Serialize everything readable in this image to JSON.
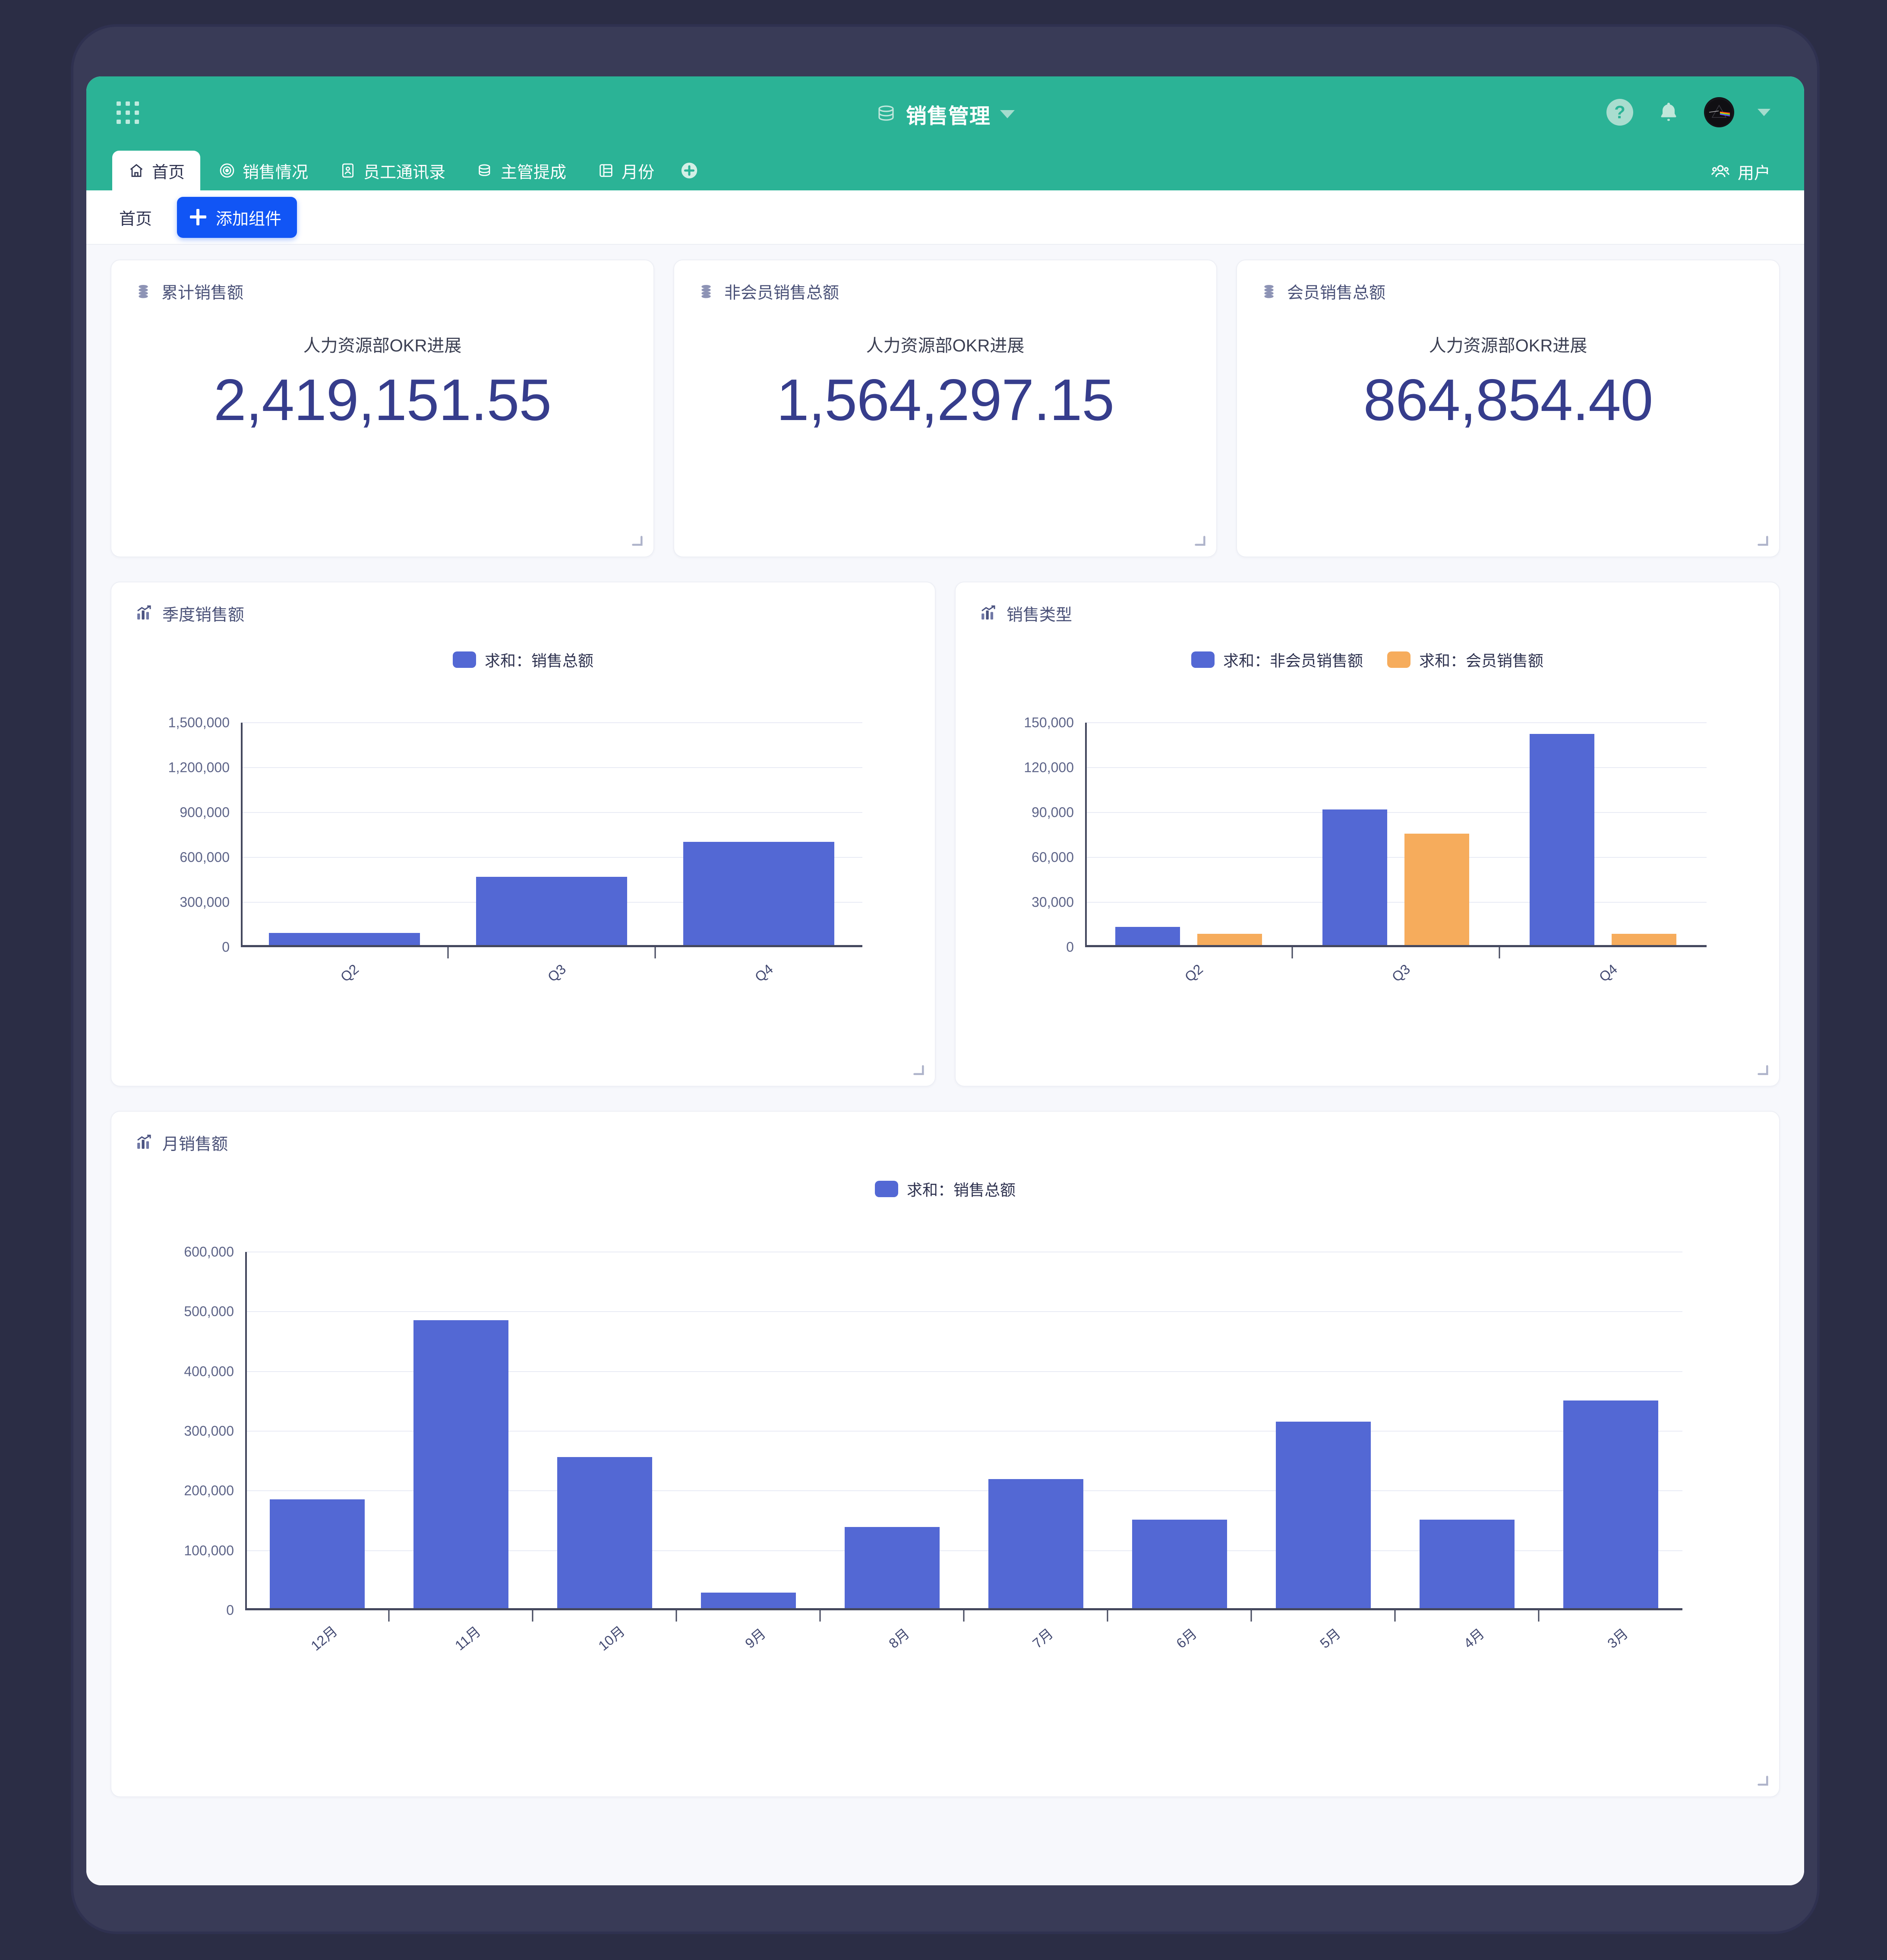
{
  "header": {
    "app_icon": "grid-apps-icon",
    "title": "销售管理",
    "title_icon": "database-icon",
    "dropdown_icon": "caret-down-icon",
    "help_icon": "help-circle-icon",
    "bell_icon": "bell-icon",
    "avatar_icon": "user-avatar",
    "avatar_caret_icon": "caret-down-icon"
  },
  "tabs": [
    {
      "label": "首页",
      "icon": "home-icon",
      "active": true
    },
    {
      "label": "销售情况",
      "icon": "target-icon",
      "active": false
    },
    {
      "label": "员工通讯录",
      "icon": "contact-card-icon",
      "active": false
    },
    {
      "label": "主管提成",
      "icon": "database-icon",
      "active": false
    },
    {
      "label": "月份",
      "icon": "list-icon",
      "active": false
    }
  ],
  "tab_add_icon": "plus-circle-icon",
  "users_button": {
    "label": "用户",
    "icon": "users-icon"
  },
  "toolbar": {
    "breadcrumb": "首页",
    "add_widget_label": "添加组件",
    "add_widget_icon": "plus-icon",
    "add_widget_color": "#1155f5"
  },
  "kpi_cards": [
    {
      "title": "累计销售额",
      "icon": "database-icon",
      "subtitle": "人力资源部OKR进展",
      "value": "2,419,151.55"
    },
    {
      "title": "非会员销售总额",
      "icon": "database-icon",
      "subtitle": "人力资源部OKR进展",
      "value": "1,564,297.15"
    },
    {
      "title": "会员销售总额",
      "icon": "database-icon",
      "subtitle": "人力资源部OKR进展",
      "value": "864,854.40"
    }
  ],
  "colors": {
    "brand_green": "#2bb396",
    "series_blue": "#5368d4",
    "series_orange": "#f6ac5c",
    "kpi_value": "#363d8c",
    "canvas_bg": "#f7f8fc"
  },
  "chart_cards": [
    {
      "title": "季度销售额",
      "icon": "bar-chart-icon"
    },
    {
      "title": "销售类型",
      "icon": "bar-chart-icon"
    },
    {
      "title": "月销售额",
      "icon": "bar-chart-icon"
    }
  ],
  "chart_data": [
    {
      "type": "bar",
      "title": "季度销售额",
      "categories": [
        "Q2",
        "Q3",
        "Q4"
      ],
      "series": [
        {
          "name": "求和：销售总额",
          "color": "#5368d4",
          "values": [
            80000,
            455000,
            690000
          ]
        }
      ],
      "legend": [
        "求和：销售总额"
      ],
      "legend_position": "top",
      "xlabel": "",
      "ylabel": "",
      "ylim": [
        0,
        1500000
      ],
      "yticks": [
        0,
        300000,
        600000,
        900000,
        1200000,
        1500000
      ],
      "ytick_labels": [
        "0",
        "300,000",
        "600,000",
        "900,000",
        "1,200,000",
        "1,500,000"
      ],
      "grid": true
    },
    {
      "type": "bar",
      "title": "销售类型",
      "categories": [
        "Q2",
        "Q3",
        "Q4"
      ],
      "series": [
        {
          "name": "求和：非会员销售额",
          "color": "#5368d4",
          "values": [
            12000,
            90500,
            141000
          ]
        },
        {
          "name": "求和：会员销售额",
          "color": "#f6ac5c",
          "values": [
            7500,
            74500,
            7500
          ]
        }
      ],
      "legend": [
        "求和：非会员销售额",
        "求和：会员销售额"
      ],
      "legend_position": "top",
      "xlabel": "",
      "ylabel": "",
      "ylim": [
        0,
        150000
      ],
      "yticks": [
        0,
        30000,
        60000,
        90000,
        120000,
        150000
      ],
      "ytick_labels": [
        "0",
        "30,000",
        "60,000",
        "90,000",
        "120,000",
        "150,000"
      ],
      "grid": true
    },
    {
      "type": "bar",
      "title": "月销售额",
      "categories": [
        "12月",
        "11月",
        "10月",
        "9月",
        "8月",
        "7月",
        "6月",
        "5月",
        "4月",
        "3月"
      ],
      "series": [
        {
          "name": "求和：销售总额",
          "color": "#5368d4",
          "values": [
            182000,
            482000,
            253000,
            26000,
            136000,
            216000,
            148000,
            312000,
            148000,
            348000
          ]
        }
      ],
      "legend": [
        "求和：销售总额"
      ],
      "legend_position": "top",
      "xlabel": "",
      "ylabel": "",
      "ylim": [
        0,
        600000
      ],
      "yticks": [
        0,
        100000,
        200000,
        300000,
        400000,
        500000,
        600000
      ],
      "ytick_labels": [
        "0",
        "100,000",
        "200,000",
        "300,000",
        "400,000",
        "500,000",
        "600,000"
      ],
      "grid": true
    }
  ],
  "resize_handle_icon": "resize-corner-icon"
}
